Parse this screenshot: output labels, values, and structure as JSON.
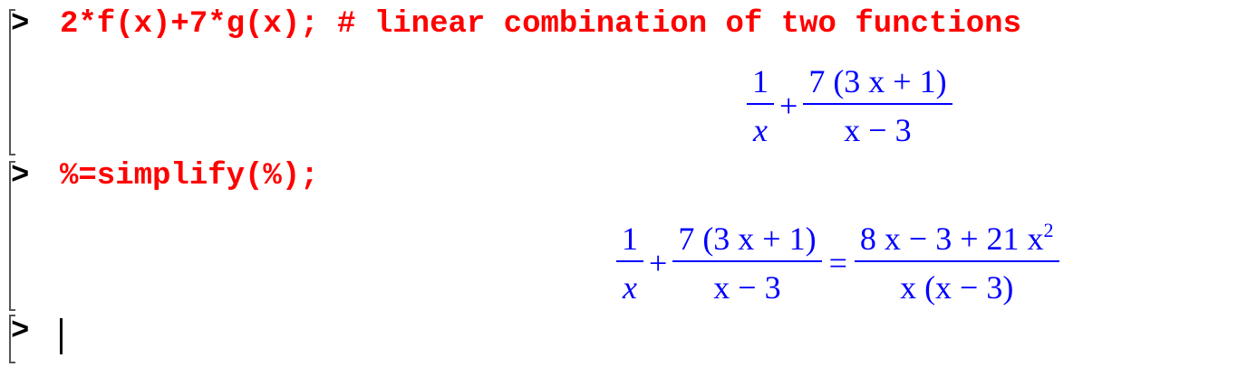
{
  "worksheet": {
    "prompt_symbol": ">",
    "cells": [
      {
        "input": "2*f(x)+7*g(x); # linear combination of two functions",
        "output": {
          "frac1_num": "1",
          "frac1_den": "x",
          "plus": "+",
          "frac2_num": "7 (3 x + 1)",
          "frac2_den": "x − 3"
        }
      },
      {
        "input": "%=simplify(%);",
        "output": {
          "frac1_num": "1",
          "frac1_den": "x",
          "plus": "+",
          "frac2_num": "7 (3 x + 1)",
          "frac2_den": "x − 3",
          "equals": "=",
          "rhs_num_base": "8 x − 3 + 21 x",
          "rhs_num_exp": "2",
          "rhs_den": "x (x − 3)"
        }
      },
      {
        "input": ""
      }
    ]
  }
}
